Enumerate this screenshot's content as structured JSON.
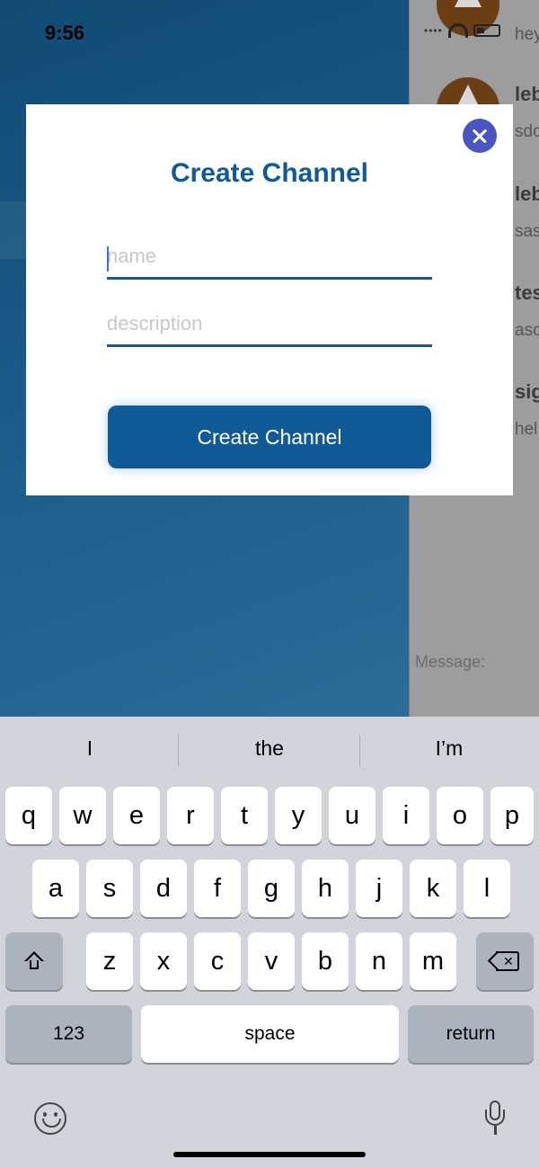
{
  "status_bar": {
    "time": "9:56"
  },
  "background": {
    "partial_title": "",
    "messages": [
      {
        "name": "leb",
        "text": "hey"
      },
      {
        "name": "leb",
        "text": "sdc"
      },
      {
        "name": "leb",
        "text": "sas"
      },
      {
        "name": "tes",
        "text": "asc"
      },
      {
        "name": "sig",
        "text": "hel"
      }
    ],
    "message_placeholder": "Message:"
  },
  "modal": {
    "title": "Create Channel",
    "name_placeholder": "name",
    "name_value": "",
    "description_placeholder": "description",
    "description_value": "",
    "submit_label": "Create Channel"
  },
  "keyboard": {
    "suggestions": [
      "I",
      "the",
      "I’m"
    ],
    "row1": [
      "q",
      "w",
      "e",
      "r",
      "t",
      "y",
      "u",
      "i",
      "o",
      "p"
    ],
    "row2": [
      "a",
      "s",
      "d",
      "f",
      "g",
      "h",
      "j",
      "k",
      "l"
    ],
    "row3": [
      "z",
      "x",
      "c",
      "v",
      "b",
      "n",
      "m"
    ],
    "numbers_label": "123",
    "space_label": "space",
    "return_label": "return"
  },
  "colors": {
    "accent": "#0f5a97",
    "close_button": "#4a55c0",
    "background": "#1d5a86"
  }
}
